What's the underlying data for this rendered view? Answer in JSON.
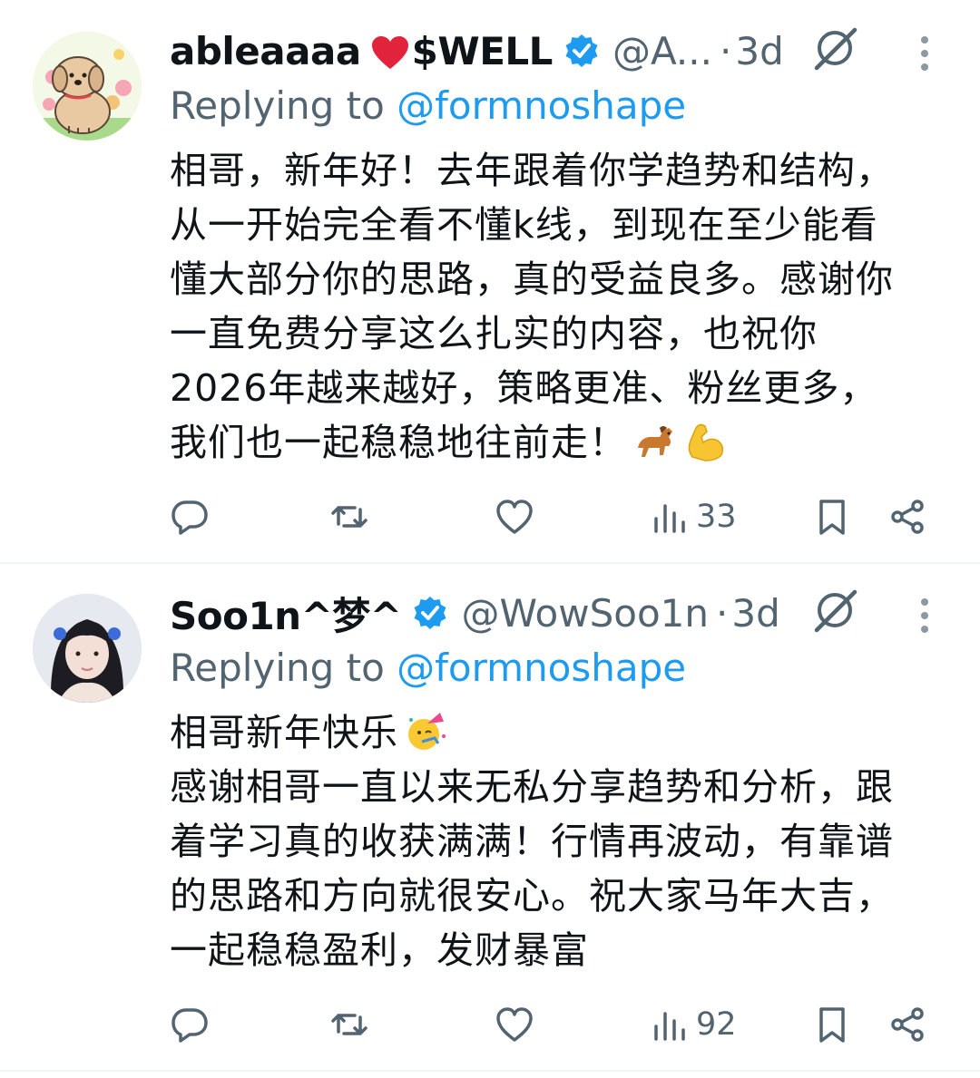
{
  "tweets": [
    {
      "name": "ableaaaa",
      "name_suffix": "$WELL",
      "handle": "@A...",
      "dot": "·",
      "time": "3d",
      "replying_prefix": "Replying to ",
      "replying_to": "@formnoshape",
      "lines": [
        "相哥，新年好！去年跟着你学趋势和结构，",
        "从一开始完全看不懂k线，到现在至少能看",
        "懂大部分你的思路，真的受益良多。感谢你",
        "一直免费分享这么扎实的内容，也祝你",
        "2026年越来越好，策略更准、粉丝更多，",
        "我们也一起稳稳地往前走！"
      ],
      "emoji_icons": [
        "horse-emoji",
        "flexed-biceps-emoji"
      ],
      "views": "33",
      "avatar": "dog-cartoon-avatar"
    },
    {
      "name": "Soo1n^梦^",
      "handle": "@WowSoo1n",
      "dot": "·",
      "time": "3d",
      "replying_prefix": "Replying to ",
      "replying_to": "@formnoshape",
      "lines": [
        "相哥新年快乐",
        "感谢相哥一直以来无私分享趋势和分析，跟",
        "着学习真的收获满满！行情再波动，有靠谱",
        "的思路和方向就很安心。祝大家马年大吉，",
        "一起稳稳盈利，发财暴富"
      ],
      "emoji_icons": [
        "partying-face-emoji"
      ],
      "views": "92",
      "avatar": "girl-photo-avatar"
    }
  ],
  "colors": {
    "text": "#0f1419",
    "secondary": "#536471",
    "link": "#1d9bf0",
    "divider": "#eff3f4"
  }
}
